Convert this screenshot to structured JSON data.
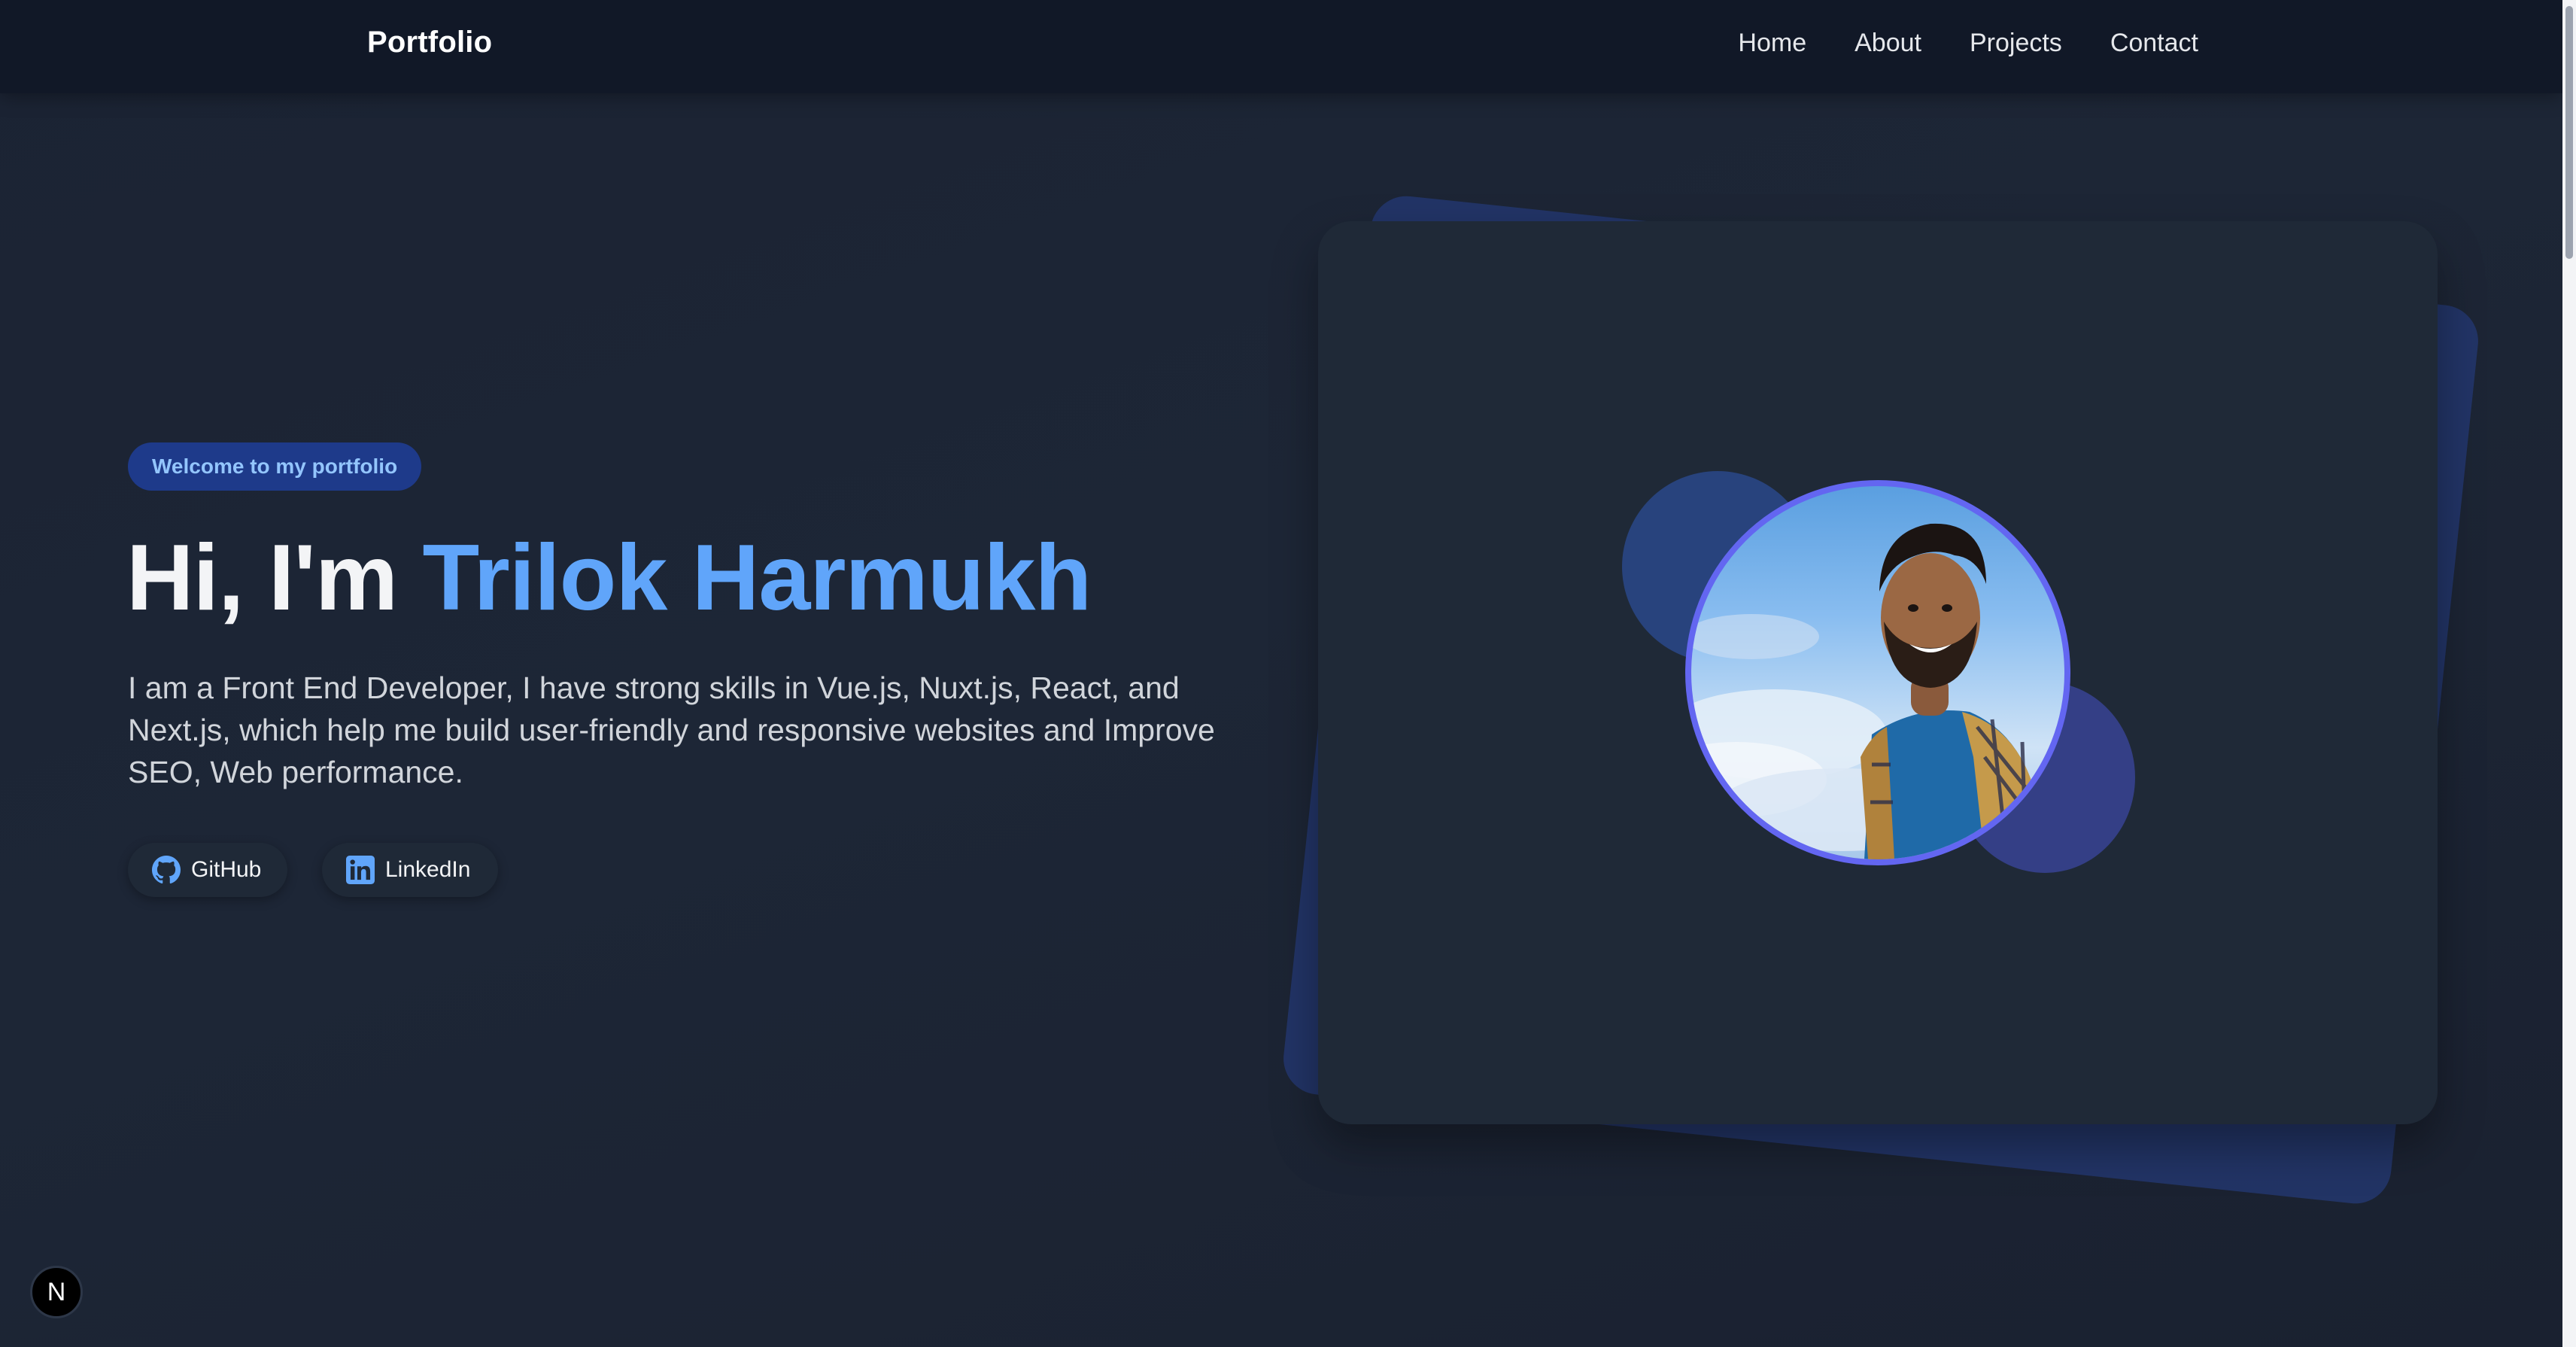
{
  "navbar": {
    "brand": "Portfolio",
    "links": [
      "Home",
      "About",
      "Projects",
      "Contact"
    ]
  },
  "hero": {
    "badge": "Welcome to my portfolio",
    "greeting": "Hi, I'm ",
    "name": "Trilok Harmukh",
    "bio": "I am a Front End Developer, I have strong skills in Vue.js, Nuxt.js, React, and Next.js, which help me build user-friendly and responsive websites and Improve SEO, Web performance.",
    "social": [
      {
        "label": "GitHub",
        "icon": "github-icon"
      },
      {
        "label": "LinkedIn",
        "icon": "linkedin-icon"
      }
    ]
  },
  "dev_indicator": {
    "letter": "N"
  },
  "colors": {
    "accent": "#60a5fa",
    "badge_bg": "#1e3a8a",
    "avatar_ring": "#6366f1",
    "navbar_bg": "#111827",
    "card_bg": "#1f2937"
  }
}
